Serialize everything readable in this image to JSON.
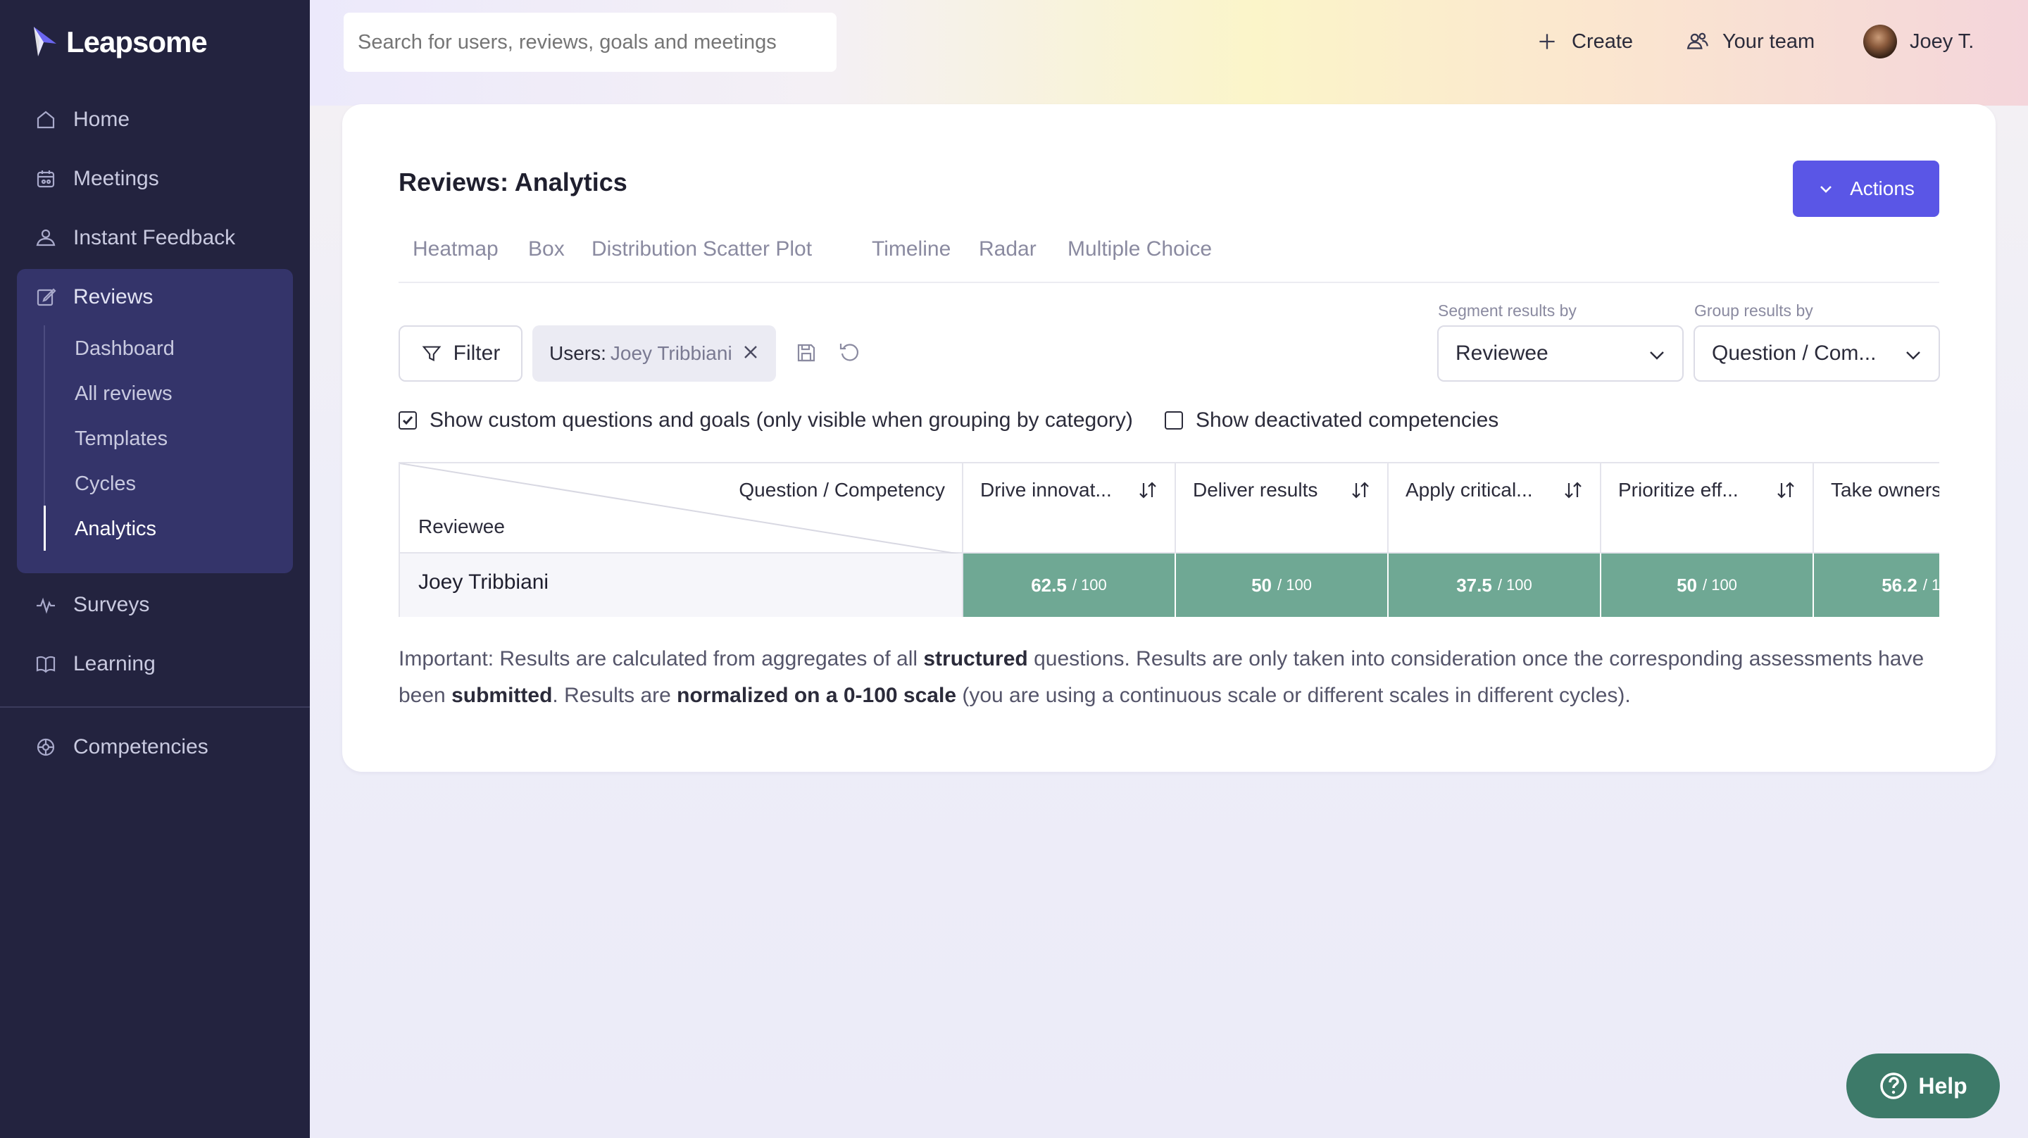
{
  "app": {
    "name": "Leapsome"
  },
  "sidebar": {
    "items": [
      {
        "label": "Home",
        "icon": "home-icon"
      },
      {
        "label": "Meetings",
        "icon": "meetings-icon"
      },
      {
        "label": "Instant Feedback",
        "icon": "feedback-icon"
      },
      {
        "label": "Reviews",
        "icon": "reviews-icon"
      },
      {
        "label": "Surveys",
        "icon": "surveys-icon"
      },
      {
        "label": "Learning",
        "icon": "learning-icon"
      },
      {
        "label": "Competencies",
        "icon": "competencies-icon"
      }
    ],
    "reviews_sub": [
      "Dashboard",
      "All reviews",
      "Templates",
      "Cycles",
      "Analytics"
    ],
    "active_sub": "Analytics"
  },
  "topbar": {
    "search_placeholder": "Search for users, reviews, goals and meetings",
    "create_label": "Create",
    "team_label": "Your team",
    "user_label": "Joey T."
  },
  "page": {
    "title": "Reviews: Analytics",
    "actions_label": "Actions",
    "tabs": [
      "Heatmap",
      "Box",
      "Distribution",
      "Scatter Plot",
      "Timeline",
      "Radar",
      "Multiple Choice"
    ]
  },
  "filters": {
    "filter_label": "Filter",
    "chip_key": "Users:",
    "chip_value": "Joey Tribbiani",
    "segment_label": "Segment results by",
    "segment_value": "Reviewee",
    "group_label": "Group results by",
    "group_value": "Question / Com..."
  },
  "options": {
    "custom_questions": {
      "label": "Show custom questions and goals (only visible when grouping by category)",
      "checked": true
    },
    "deactivated": {
      "label": "Show deactivated competencies",
      "checked": false
    }
  },
  "table": {
    "corner_top": "Question / Competency",
    "corner_bottom": "Reviewee",
    "columns": [
      "Drive innovat...",
      "Deliver results",
      "Apply critical...",
      "Prioritize eff...",
      "Take owners"
    ],
    "rows": [
      {
        "name": "Joey Tribbiani",
        "values": [
          "62.5",
          "50",
          "37.5",
          "50",
          "56.2"
        ],
        "max": "/ 100"
      }
    ]
  },
  "note": {
    "p1": "Important: Results are calculated from aggregates of all ",
    "b1": "structured",
    "p2": " questions. Results are only taken into consideration once the corresponding assessments have been ",
    "b2": "submitted",
    "p3": ". Results are ",
    "b3": "normalized on a 0-100 scale",
    "p4": " (you are using a continuous scale or different scales in different cycles)."
  },
  "help": {
    "label": "Help"
  },
  "colors": {
    "sidebar": "#23233f",
    "accent": "#5a56e6",
    "heat_cell": "#6fa894",
    "help": "#3d7a69"
  }
}
